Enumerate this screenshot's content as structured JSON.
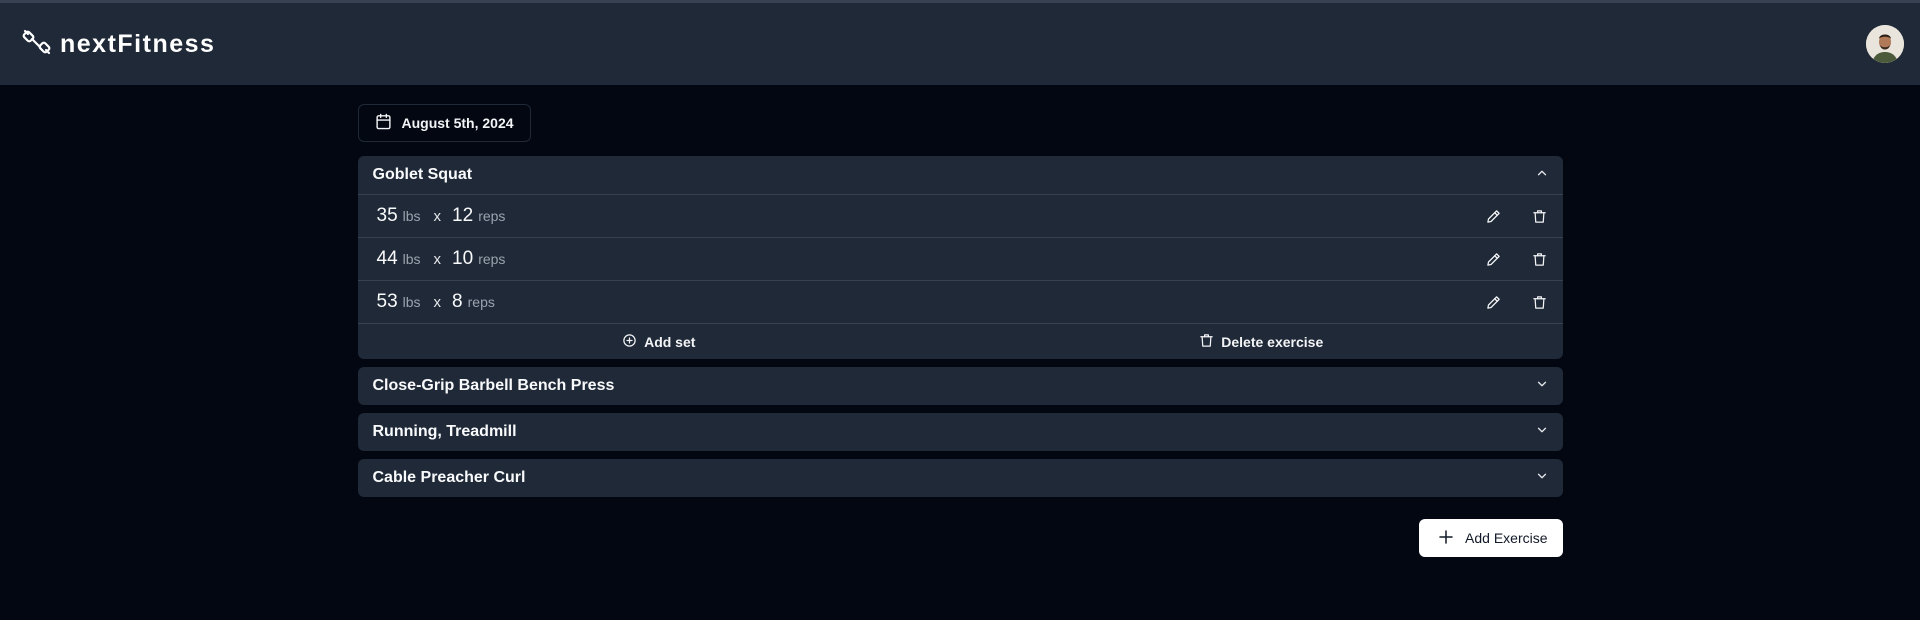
{
  "app": {
    "name": "nextFitness",
    "logo_icon": "dumbbell-icon",
    "avatar_icon": "user-avatar"
  },
  "date_picker": {
    "label": "August 5th, 2024",
    "icon": "calendar-icon"
  },
  "workout": {
    "expanded": {
      "title": "Goblet Squat",
      "sets": [
        {
          "weight": "35",
          "weight_unit": "lbs",
          "times": "x",
          "reps": "12",
          "reps_unit": "reps"
        },
        {
          "weight": "44",
          "weight_unit": "lbs",
          "times": "x",
          "reps": "10",
          "reps_unit": "reps"
        },
        {
          "weight": "53",
          "weight_unit": "lbs",
          "times": "x",
          "reps": "8",
          "reps_unit": "reps"
        }
      ],
      "add_set_label": "Add set",
      "delete_exercise_label": "Delete exercise"
    },
    "collapsed": [
      {
        "title": "Close-Grip Barbell Bench Press"
      },
      {
        "title": "Running, Treadmill"
      },
      {
        "title": "Cable Preacher Curl"
      }
    ]
  },
  "add_exercise_label": "Add Exercise",
  "colors": {
    "background": "#030712",
    "panel": "#1f2937",
    "divider": "#374151",
    "muted": "#9ca3af"
  }
}
